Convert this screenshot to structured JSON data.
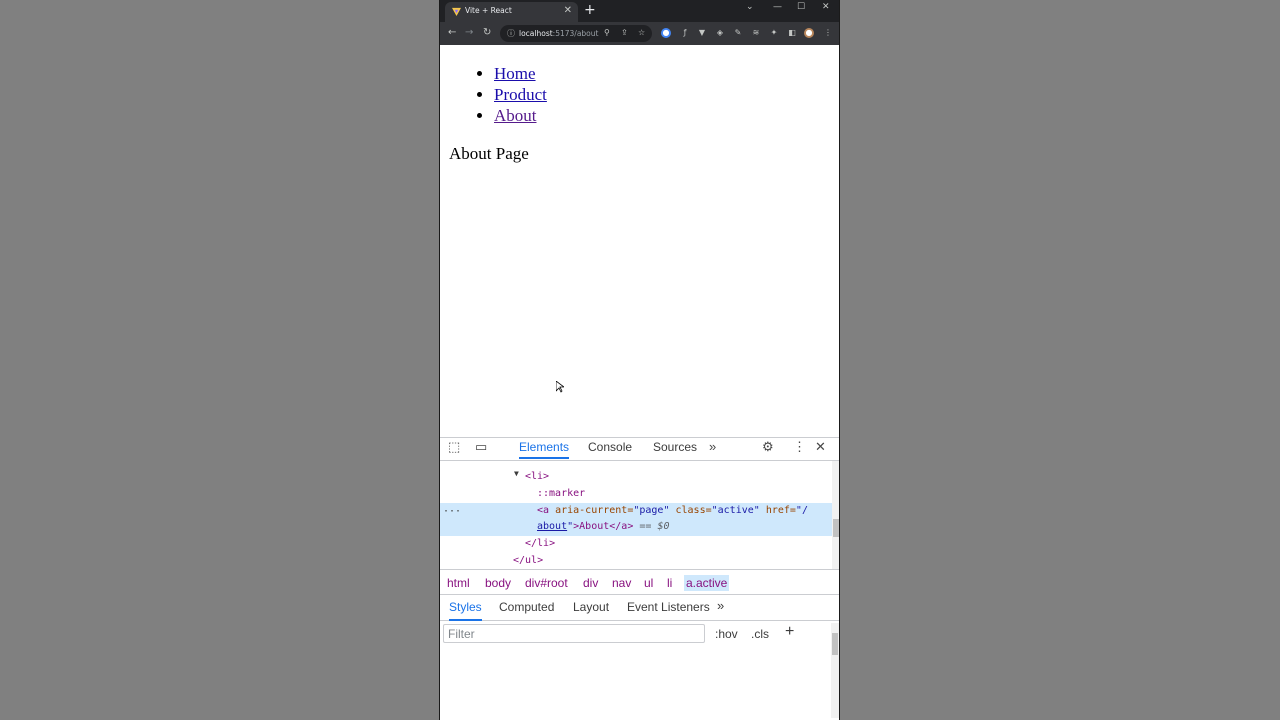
{
  "browser": {
    "tab_title": "Vite + React",
    "new_tab_symbol": "+",
    "url_host": "localhost",
    "url_path": ":5173/about"
  },
  "page": {
    "nav_items": [
      "Home",
      "Product",
      "About"
    ],
    "heading": "About Page"
  },
  "devtools": {
    "tabs": [
      "Elements",
      "Console",
      "Sources"
    ],
    "dom": {
      "line_li_open": "<li>",
      "marker": "::marker",
      "a_tag_open": "<a",
      "attr_aria_name": " aria-current=",
      "attr_aria_val": "\"page\"",
      "attr_class_name": " class=",
      "attr_class_val": "\"active\"",
      "attr_href_name": " href=",
      "attr_href_val1": "\"/",
      "attr_href_val2": "about",
      "attr_href_val3": "\"",
      "a_text": ">About</a>",
      "eq_marker": " == $0",
      "li_close": "</li>",
      "ul_close": "</ul>"
    },
    "breadcrumbs": [
      "html",
      "body",
      "div#root",
      "div",
      "nav",
      "ul",
      "li",
      "a.active"
    ],
    "subtabs": [
      "Styles",
      "Computed",
      "Layout",
      "Event Listeners"
    ],
    "filter_placeholder": "Filter",
    "hov_label": ":hov",
    "cls_label": ".cls",
    "plus_label": "+"
  }
}
